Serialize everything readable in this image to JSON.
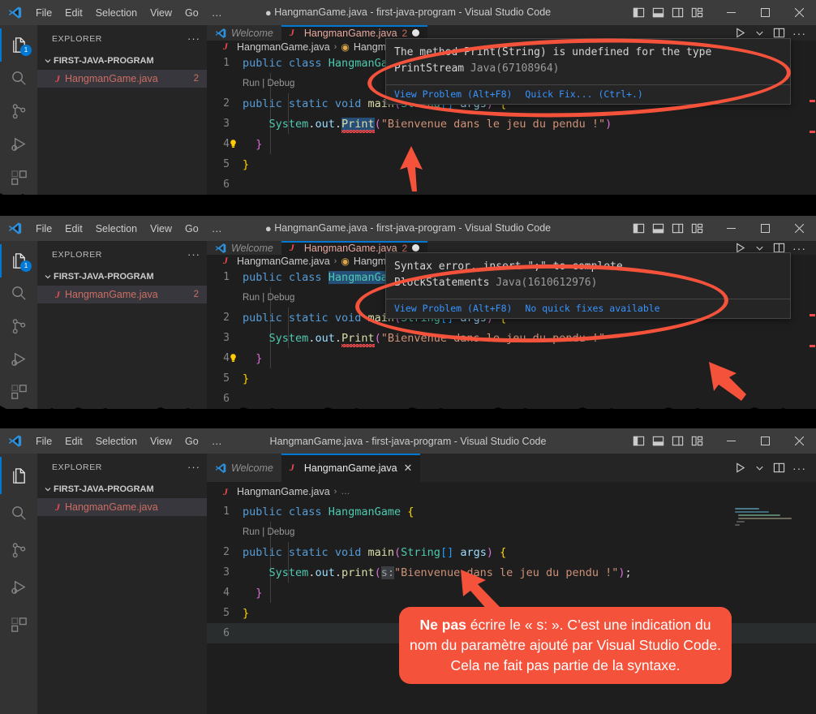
{
  "window": {
    "menus": [
      "File",
      "Edit",
      "Selection",
      "View",
      "Go"
    ],
    "menu_overflow": "…",
    "title_unsaved": "HangmanGame.java - first-java-program - Visual Studio Code",
    "title_saved": "HangmanGame.java - first-java-program - Visual Studio Code",
    "dirty_marker": "●",
    "layout_buttons": [
      "toggle-primary-sidebar",
      "toggle-panel",
      "toggle-secondary-sidebar",
      "customize-layout"
    ],
    "window_buttons": [
      "minimize",
      "maximize",
      "close"
    ]
  },
  "activity_bar": {
    "items": [
      {
        "name": "explorer",
        "badge": "1"
      },
      {
        "name": "search",
        "badge": ""
      },
      {
        "name": "source-control",
        "badge": ""
      },
      {
        "name": "run-and-debug",
        "badge": ""
      },
      {
        "name": "extensions",
        "badge": ""
      }
    ]
  },
  "sidebar": {
    "title": "EXPLORER",
    "more_actions": "···",
    "folder": "FIRST-JAVA-PROGRAM",
    "file_with_errors": {
      "name": "HangmanGame.java",
      "icon": "J",
      "error_count": "2"
    },
    "file_clean": {
      "name": "HangmanGame.java",
      "icon": "J",
      "error_count": ""
    }
  },
  "tabs": {
    "welcome": "Welcome",
    "file_dirty": {
      "label": "HangmanGame.java",
      "error_count": "2",
      "state": "unsaved"
    },
    "file_saved": {
      "label": "HangmanGame.java",
      "close": "✕",
      "state": "saved"
    },
    "actions": [
      "run-icon",
      "chevron-down-icon",
      "split-editor-icon",
      "more-actions-icon"
    ]
  },
  "breadcrumbs": {
    "file": "HangmanGame.java",
    "separator": "›",
    "symbol": "HangmanGame",
    "collapsed": "…"
  },
  "panels": [
    {
      "id": "panel-1",
      "lines": [
        {
          "num": "1",
          "text": "public class HangmanGame {"
        },
        {
          "num": "",
          "text": "Run | Debug",
          "is_codelens": true
        },
        {
          "num": "2",
          "text": "public static void main(String[] args) {"
        },
        {
          "num": "3",
          "text": "System.out.Print(\"Bienvenue dans le jeu du pendu !\")"
        },
        {
          "num": "4",
          "text": "}"
        },
        {
          "num": "5",
          "text": "}"
        },
        {
          "num": "6",
          "text": ""
        }
      ],
      "hover": {
        "message_line1": "The method Print(String) is undefined for the type",
        "message_line2": "PrintStream",
        "source": "Java(67108964)",
        "action_primary": "View Problem",
        "action_primary_key": "(Alt+F8)",
        "action_secondary": "Quick Fix...",
        "action_secondary_key": "(Ctrl+.)"
      }
    },
    {
      "id": "panel-2",
      "lines": [
        {
          "num": "1",
          "text": "public class HangmanGame {"
        },
        {
          "num": "",
          "text": "Run | Debug",
          "is_codelens": true
        },
        {
          "num": "2",
          "text": "public static void main(String[] args) {"
        },
        {
          "num": "3",
          "text": "System.out.Print(\"Bienvenue dans le jeu du pendu !\""
        },
        {
          "num": "4",
          "text": "}"
        },
        {
          "num": "5",
          "text": "}"
        },
        {
          "num": "6",
          "text": ""
        }
      ],
      "hover": {
        "message_line1": "Syntax error, insert \";\" to complete",
        "message_line2": "BlockStatements",
        "source": "Java(1610612976)",
        "action_primary": "View Problem",
        "action_primary_key": "(Alt+F8)",
        "action_secondary": "No quick fixes available",
        "action_secondary_key": ""
      }
    },
    {
      "id": "panel-3",
      "lines": [
        {
          "num": "1",
          "text": "public class HangmanGame {"
        },
        {
          "num": "",
          "text": "Run | Debug",
          "is_codelens": true
        },
        {
          "num": "2",
          "text": "public static void main(String[] args) {"
        },
        {
          "num": "3",
          "text": "System.out.print(s:\"Bienvenue dans le jeu du pendu !\");"
        },
        {
          "num": "4",
          "text": "}"
        },
        {
          "num": "5",
          "text": "}"
        },
        {
          "num": "6",
          "text": ""
        }
      ],
      "hover": null
    }
  ],
  "code_tokens": {
    "kw_public": "public",
    "kw_class": "class",
    "kw_static": "static",
    "kw_void": "void",
    "type_hangman": "HangmanGame",
    "type_string": "String",
    "method_main": "main",
    "var_args": "args",
    "system": "System",
    "out": "out",
    "print_wrong": "Print",
    "print_right": "print",
    "string_literal": "\"Bienvenue dans le jeu du pendu !\"",
    "param_hint": "s:",
    "brace_open": "{",
    "brace_close": "}",
    "semicolon": ";",
    "codelens_run": "Run",
    "codelens_divider": "|",
    "codelens_debug": "Debug"
  },
  "annotation": {
    "callout_bold": "Ne pas",
    "callout_text": " écrire le « s: ». C’est une indication du nom du paramètre ajouté par Visual Studio Code. Cela ne fait pas partie de la syntaxe.",
    "accent_color": "#f4523b",
    "arrows": [
      "arrow-up-to-print",
      "arrow-up-to-missing-semicolon",
      "arrow-up-to-param-hint"
    ],
    "ellipses": [
      "ellipse-around-hover-1",
      "ellipse-around-hover-2"
    ]
  }
}
